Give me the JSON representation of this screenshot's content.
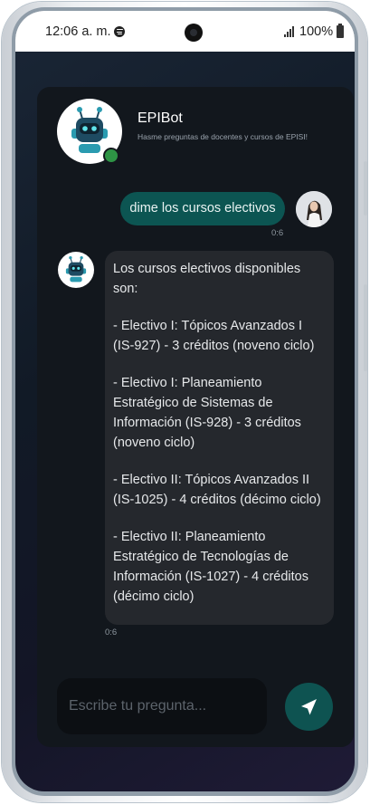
{
  "status_bar": {
    "time": "12:06 a. m.",
    "battery": "100%",
    "icons": [
      "spotify-icon",
      "camera-cutout",
      "signal-icon",
      "battery-icon"
    ]
  },
  "chat_header": {
    "bot_name": "EPIBot",
    "subtitle": "Hasme preguntas de docentes y cursos de EPISI!",
    "status_color": "#2e9445"
  },
  "messages": [
    {
      "sender": "user",
      "text": "dime los cursos electivos",
      "time": "0:6"
    },
    {
      "sender": "bot",
      "paragraphs": [
        "Los cursos electivos disponibles son:",
        "- Electivo I: Tópicos Avanzados I (IS-927) - 3 créditos (noveno ciclo)",
        "- Electivo I: Planeamiento Estratégico de Sistemas de Información (IS-928) - 3 créditos (noveno ciclo)",
        "- Electivo II: Tópicos Avanzados II (IS-1025) - 4 créditos (décimo ciclo)",
        "- Electivo II: Planeamiento Estratégico de Tecnologías de Información (IS-1027) - 4 créditos (décimo ciclo)"
      ],
      "time": "0:6"
    }
  ],
  "composer": {
    "placeholder": "Escribe tu pregunta...",
    "send_icon": "send-icon"
  },
  "colors": {
    "accent": "#0c5552",
    "bubble_bot": "#25282d",
    "card": "#12171d"
  }
}
